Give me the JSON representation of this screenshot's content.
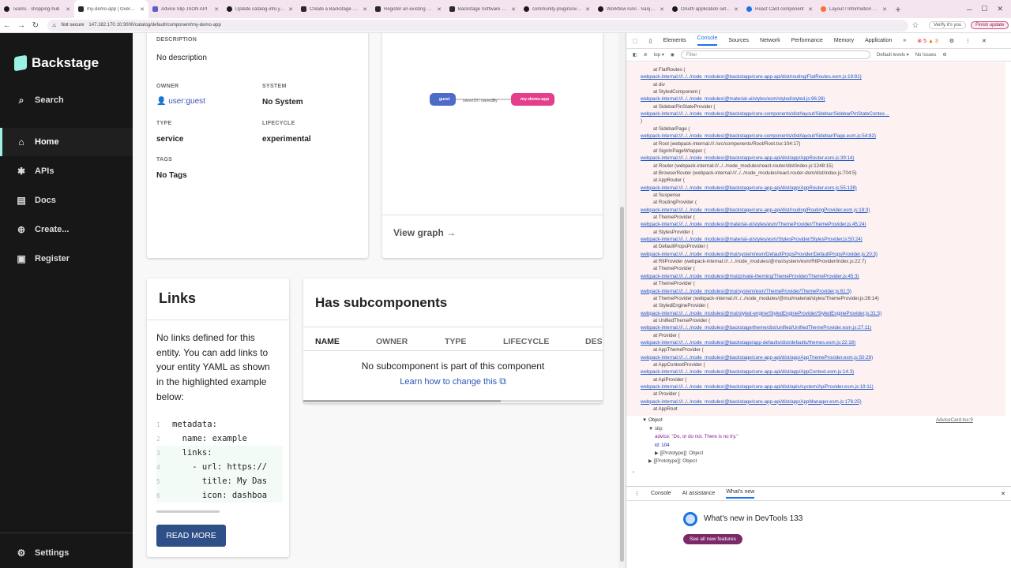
{
  "browser": {
    "tabs": [
      {
        "label": "Teams · shopping-hub",
        "icon": "github-icon"
      },
      {
        "label": "my-demo-app | Overview",
        "icon": "backstage-icon",
        "active": true
      },
      {
        "label": "Advice Slip JSON API",
        "icon": "page-icon"
      },
      {
        "label": "Update catalog-info.yaml",
        "icon": "github-icon"
      },
      {
        "label": "Create a Backstage Plugin",
        "icon": "backstage-icon"
      },
      {
        "label": "Register an existing component",
        "icon": "backstage-icon"
      },
      {
        "label": "Backstage Software Catalog",
        "icon": "backstage-icon"
      },
      {
        "label": "community-plugins/work",
        "icon": "github-icon"
      },
      {
        "label": "Workflow runs · Sanjeev",
        "icon": "github-icon"
      },
      {
        "label": "OAuth application settings",
        "icon": "github-icon"
      },
      {
        "label": "React Card component",
        "icon": "mui-icon"
      },
      {
        "label": "Layout / Information Card",
        "icon": "storybook-icon"
      }
    ],
    "not_secure": "Not secure",
    "url": "147.182.170.10:3000/catalog/default/component/my-demo-app",
    "verify": "Verify it's you",
    "finish_update": "Finish update"
  },
  "sidebar": {
    "logo": "Backstage",
    "search": "Search",
    "items": [
      {
        "label": "Home",
        "icon": "home-icon",
        "active": true
      },
      {
        "label": "APIs",
        "icon": "puzzle-icon"
      },
      {
        "label": "Docs",
        "icon": "docs-icon"
      },
      {
        "label": "Create...",
        "icon": "plus-circle-icon"
      },
      {
        "label": "Register",
        "icon": "register-icon"
      }
    ],
    "settings": "Settings"
  },
  "about": {
    "description_label": "DESCRIPTION",
    "description": "No description",
    "owner_label": "OWNER",
    "owner": "user:guest",
    "system_label": "SYSTEM",
    "system": "No System",
    "type_label": "TYPE",
    "type": "service",
    "lifecycle_label": "LIFECYCLE",
    "lifecycle": "experimental",
    "tags_label": "TAGS",
    "tags": "No Tags"
  },
  "relations": {
    "node_guest": "guest",
    "edge_label": "ownerOf / ownedBy",
    "node_app": "my-demo-app",
    "view_graph": "View graph"
  },
  "links": {
    "title": "Links",
    "text": "No links defined for this entity. You can add links to your entity YAML as shown in the highlighted example below:",
    "code": [
      {
        "n": "1",
        "t": "metadata:"
      },
      {
        "n": "2",
        "t": "  name: example"
      },
      {
        "n": "3",
        "t": "  links:"
      },
      {
        "n": "4",
        "t": "    - url: https://"
      },
      {
        "n": "5",
        "t": "      title: My Das"
      },
      {
        "n": "6",
        "t": "      icon: dashboa"
      }
    ],
    "read_more": "READ MORE"
  },
  "subcomponents": {
    "title": "Has subcomponents",
    "columns": [
      "NAME",
      "OWNER",
      "TYPE",
      "LIFECYCLE",
      "DES"
    ],
    "empty": "No subcomponent is part of this component",
    "learn": "Learn how to change this"
  },
  "devtools": {
    "tabs": [
      "Elements",
      "Console",
      "Sources",
      "Network",
      "Performance",
      "Memory",
      "Application"
    ],
    "errors": "5",
    "warnings": "3",
    "top": "top",
    "filter": "Filter",
    "levels": "Default levels",
    "issues": "No Issues",
    "lines": [
      {
        "t": "at FlatRoutes (",
        "k": "at",
        "i": 1
      },
      {
        "t": "webpack-internal:///../../node_modules/@backstage/core-app-api/dist/routing/FlatRoutes.esm.js:19:81)",
        "k": "link",
        "i": 0
      },
      {
        "t": "at div",
        "k": "at",
        "i": 1
      },
      {
        "t": "at StyledComponent (",
        "k": "at",
        "i": 1
      },
      {
        "t": "webpack-internal:///../../node_modules/@material-ui/styles/esm/styled/styled.js:96:28)",
        "k": "link",
        "i": 0
      },
      {
        "t": "at SidebarPinStateProvider (",
        "k": "at",
        "i": 1
      },
      {
        "t": "webpack-internal:///../../node_modules/@backstage/core-components/dist/layout/Sidebar/SidebarPinStateContex…",
        "k": "link",
        "i": 0
      },
      {
        "t": ")",
        "k": "at",
        "i": 0
      },
      {
        "t": "at SidebarPage (",
        "k": "at",
        "i": 1
      },
      {
        "t": "webpack-internal:///../../node_modules/@backstage/core-components/dist/layout/Sidebar/Page.esm.js:54:82)",
        "k": "link",
        "i": 0
      },
      {
        "t": "at Root (webpack-internal:///./src/components/Root/Root.tsx:104:17)",
        "k": "at",
        "i": 1
      },
      {
        "t": "at SignInPageWrapper (",
        "k": "at",
        "i": 1
      },
      {
        "t": "webpack-internal:///../../node_modules/@backstage/core-app-api/dist/app/AppRouter.esm.js:39:14)",
        "k": "link",
        "i": 0
      },
      {
        "t": "at Router (webpack-internal:///../../node_modules/react-router/dist/index.js:1248:15)",
        "k": "at",
        "i": 1
      },
      {
        "t": "at BrowserRouter (webpack-internal:///../../node_modules/react-router-dom/dist/index.js:704:5)",
        "k": "at",
        "i": 1
      },
      {
        "t": "at AppRouter (",
        "k": "at",
        "i": 1
      },
      {
        "t": "webpack-internal:///../../node_modules/@backstage/core-app-api/dist/app/AppRouter.esm.js:55:138)",
        "k": "link",
        "i": 0
      },
      {
        "t": "at Suspense",
        "k": "at",
        "i": 1
      },
      {
        "t": "at RoutingProvider (",
        "k": "at",
        "i": 1
      },
      {
        "t": "webpack-internal:///../../node_modules/@backstage/core-app-api/dist/routing/RoutingProvider.esm.js:18:3)",
        "k": "link",
        "i": 0
      },
      {
        "t": "at ThemeProvider (",
        "k": "at",
        "i": 1
      },
      {
        "t": "webpack-internal:///../../node_modules/@material-ui/styles/esm/ThemeProvider/ThemeProvider.js:45:24)",
        "k": "link",
        "i": 0
      },
      {
        "t": "at StylesProvider (",
        "k": "at",
        "i": 1
      },
      {
        "t": "webpack-internal:///../../node_modules/@material-ui/styles/esm/StylesProvider/StylesProvider.js:50:24)",
        "k": "link",
        "i": 0
      },
      {
        "t": "at DefaultPropsProvider (",
        "k": "at",
        "i": 1
      },
      {
        "t": "webpack-internal:///../../node_modules/@mui/system/esm/DefaultPropsProvider/DefaultPropsProvider.js:20:3)",
        "k": "link",
        "i": 0
      },
      {
        "t": "at RtlProvider (webpack-internal:///../../node_modules/@mui/system/esm/RtlProvider/index.js:22:7)",
        "k": "at",
        "i": 1
      },
      {
        "t": "at ThemeProvider (",
        "k": "at",
        "i": 1
      },
      {
        "t": "webpack-internal:///../../node_modules/@mui/private-theming/ThemeProvider/ThemeProvider.js:45:3)",
        "k": "link",
        "i": 0
      },
      {
        "t": "at ThemeProvider (",
        "k": "at",
        "i": 1
      },
      {
        "t": "webpack-internal:///../../node_modules/@mui/system/esm/ThemeProvider/ThemeProvider.js:61:5)",
        "k": "link",
        "i": 0
      },
      {
        "t": "at ThemeProvider (webpack-internal:///../../node_modules/@mui/material/styles/ThemeProvider.js:26:14)",
        "k": "at",
        "i": 1
      },
      {
        "t": "at StyledEngineProvider (",
        "k": "at",
        "i": 1
      },
      {
        "t": "webpack-internal:///../../node_modules/@mui/styled-engine/StyledEngineProvider/StyledEngineProvider.js:31:5)",
        "k": "link",
        "i": 0
      },
      {
        "t": "at UnifiedThemeProvider (",
        "k": "at",
        "i": 1
      },
      {
        "t": "webpack-internal:///../../node_modules/@backstage/theme/dist/unified/UnifiedThemeProvider.esm.js:27:11)",
        "k": "link",
        "i": 0
      },
      {
        "t": "at Provider (",
        "k": "at",
        "i": 1
      },
      {
        "t": "webpack-internal:///../../node_modules/@backstage/app-defaults/dist/defaults/themes.esm.js:22:18)",
        "k": "link",
        "i": 0
      },
      {
        "t": "at AppThemeProvider (",
        "k": "at",
        "i": 1
      },
      {
        "t": "webpack-internal:///../../node_modules/@backstage/core-app-api/dist/app/AppThemeProvider.esm.js:50:29)",
        "k": "link",
        "i": 0
      },
      {
        "t": "at AppContextProvider (",
        "k": "at",
        "i": 1
      },
      {
        "t": "webpack-internal:///../../node_modules/@backstage/core-app-api/dist/app/AppContext.esm.js:14:3)",
        "k": "link",
        "i": 0
      },
      {
        "t": "at ApiProvider (",
        "k": "at",
        "i": 1
      },
      {
        "t": "webpack-internal:///../../node_modules/@backstage/core-app-api/dist/apis/system/ApiProvider.esm.js:19:11)",
        "k": "link",
        "i": 0
      },
      {
        "t": "at Provider (",
        "k": "at",
        "i": 1
      },
      {
        "t": "webpack-internal:///../../node_modules/@backstage/core-app-api/dist/app/AppManager.esm.js:176:25)",
        "k": "link",
        "i": 0
      },
      {
        "t": "at AppRoot",
        "k": "at",
        "i": 1
      }
    ],
    "object_label": "▼ Object",
    "object_source": "AdviceCard.tsx:9",
    "obj_lines": [
      {
        "t": "▼ slip:",
        "i": 1
      },
      {
        "t": "advice: \"Do, or do not. There is no try.\"",
        "i": 2
      },
      {
        "t": "id: 104",
        "i": 2
      },
      {
        "t": "▶ [[Prototype]]: Object",
        "i": 2
      },
      {
        "t": "▶ [[Prototype]]: Object",
        "i": 1
      }
    ],
    "drawer_tabs": [
      "Console",
      "AI assistance",
      "What's new"
    ],
    "whats_new_title": "What's new in DevTools 133",
    "see_all": "See all new features"
  }
}
